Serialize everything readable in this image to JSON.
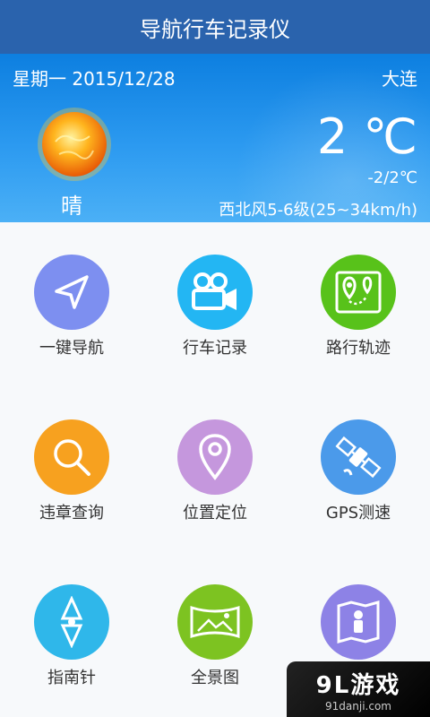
{
  "app": {
    "title": "导航行车记录仪"
  },
  "weather": {
    "date": "星期一 2015/12/28",
    "city": "大连",
    "temperature": "2 ℃",
    "range": "-2/2℃",
    "condition": "晴",
    "wind": "西北风5-6级(25~34km/h)",
    "icon": "sun-icon"
  },
  "grid": {
    "items": [
      {
        "label": "一键导航",
        "icon": "navigation-arrow-icon",
        "color": "#7d8ff0"
      },
      {
        "label": "行车记录",
        "icon": "video-camera-icon",
        "color": "#23b6f3"
      },
      {
        "label": "路行轨迹",
        "icon": "route-map-icon",
        "color": "#58c21a"
      },
      {
        "label": "违章查询",
        "icon": "search-icon",
        "color": "#f7a11f"
      },
      {
        "label": "位置定位",
        "icon": "location-pin-icon",
        "color": "#c597dd"
      },
      {
        "label": "GPS测速",
        "icon": "satellite-icon",
        "color": "#4b9aea"
      },
      {
        "label": "指南针",
        "icon": "compass-icon",
        "color": "#2fb7ea"
      },
      {
        "label": "全景图",
        "icon": "panorama-icon",
        "color": "#7dc321"
      },
      {
        "label": "",
        "icon": "map-person-icon",
        "color": "#8d82e6"
      }
    ]
  },
  "watermark": {
    "brand": "9L游戏",
    "url": "91danji.com"
  }
}
